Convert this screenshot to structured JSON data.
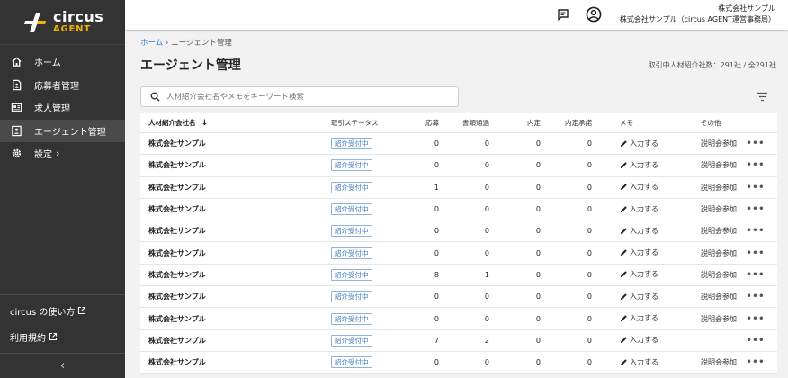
{
  "brand": {
    "line1": "circus",
    "line2": "AGENT",
    "accent": "#f0b400"
  },
  "sidebar": {
    "items": [
      {
        "label": "ホーム",
        "icon": "home-icon"
      },
      {
        "label": "応募者管理",
        "icon": "applicant-icon"
      },
      {
        "label": "求人管理",
        "icon": "job-icon"
      },
      {
        "label": "エージェント管理",
        "icon": "agent-icon",
        "active": true
      },
      {
        "label": "設定",
        "icon": "gear-icon",
        "chevron": "›"
      }
    ],
    "links": [
      {
        "label": "circus の使い方"
      },
      {
        "label": "利用規約"
      }
    ],
    "collapse": "‹"
  },
  "header": {
    "company": "株式会社サンプル",
    "office": "株式会社サンプル（circus AGENT運営事務局）"
  },
  "breadcrumb": {
    "home": "ホーム",
    "sep": "›",
    "current": "エージェント管理"
  },
  "page": {
    "title": "エージェント管理",
    "count": "取引中人材紹介社数：291社 / 全291社"
  },
  "search": {
    "placeholder": "人材紹介会社名やメモをキーワード検索"
  },
  "table": {
    "headers": {
      "name": "人材紹介会社名",
      "sort": "↓",
      "status": "取引ステータス",
      "apply": "応募",
      "docs": "書類通過",
      "offer": "内定",
      "accept": "内定承諾",
      "memo": "メモ",
      "other": "その他"
    },
    "rows": [
      {
        "name": "株式会社サンプル",
        "status": "紹介受付中",
        "apply": "0",
        "docs": "0",
        "offer": "0",
        "accept": "0",
        "memo": "入力する",
        "other": "説明会参加",
        "more": "•••"
      },
      {
        "name": "株式会社サンプル",
        "status": "紹介受付中",
        "apply": "0",
        "docs": "0",
        "offer": "0",
        "accept": "0",
        "memo": "入力する",
        "other": "説明会参加",
        "more": "•••"
      },
      {
        "name": "株式会社サンプル",
        "status": "紹介受付中",
        "apply": "1",
        "docs": "0",
        "offer": "0",
        "accept": "0",
        "memo": "入力する",
        "other": "説明会参加",
        "more": "•••"
      },
      {
        "name": "株式会社サンプル",
        "status": "紹介受付中",
        "apply": "0",
        "docs": "0",
        "offer": "0",
        "accept": "0",
        "memo": "入力する",
        "other": "説明会参加",
        "more": "•••"
      },
      {
        "name": "株式会社サンプル",
        "status": "紹介受付中",
        "apply": "0",
        "docs": "0",
        "offer": "0",
        "accept": "0",
        "memo": "入力する",
        "other": "説明会参加",
        "more": "•••"
      },
      {
        "name": "株式会社サンプル",
        "status": "紹介受付中",
        "apply": "0",
        "docs": "0",
        "offer": "0",
        "accept": "0",
        "memo": "入力する",
        "other": "説明会参加",
        "more": "•••"
      },
      {
        "name": "株式会社サンプル",
        "status": "紹介受付中",
        "apply": "8",
        "docs": "1",
        "offer": "0",
        "accept": "0",
        "memo": "入力する",
        "other": "説明会参加",
        "more": "•••"
      },
      {
        "name": "株式会社サンプル",
        "status": "紹介受付中",
        "apply": "0",
        "docs": "0",
        "offer": "0",
        "accept": "0",
        "memo": "入力する",
        "other": "説明会参加",
        "more": "•••"
      },
      {
        "name": "株式会社サンプル",
        "status": "紹介受付中",
        "apply": "0",
        "docs": "0",
        "offer": "0",
        "accept": "0",
        "memo": "入力する",
        "other": "説明会参加",
        "more": "•••"
      },
      {
        "name": "株式会社サンプル",
        "status": "紹介受付中",
        "apply": "7",
        "docs": "2",
        "offer": "0",
        "accept": "0",
        "memo": "入力する",
        "other": "",
        "more": "•••"
      },
      {
        "name": "株式会社サンプル",
        "status": "紹介受付中",
        "apply": "0",
        "docs": "0",
        "offer": "0",
        "accept": "0",
        "memo": "入力する",
        "other": "説明会参加",
        "more": "•••"
      }
    ]
  }
}
